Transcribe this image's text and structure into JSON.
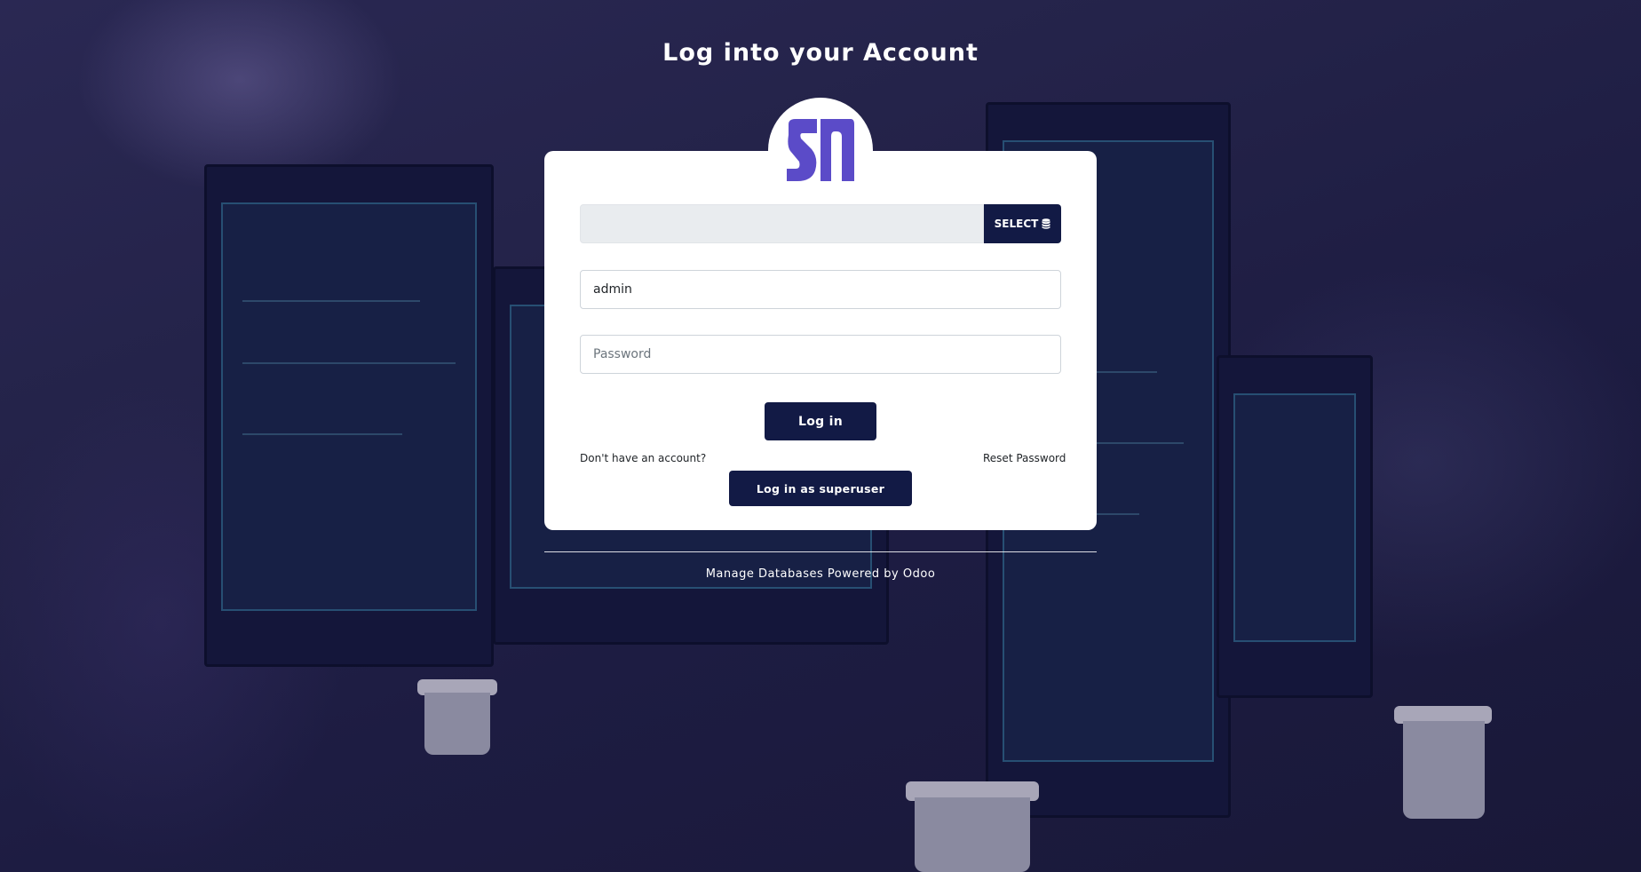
{
  "page": {
    "title": "Log into your Account"
  },
  "logo": {
    "icon": "brand-logo-icon",
    "color": "#5b4bc8"
  },
  "database": {
    "value": "",
    "select_label": "SELECT",
    "select_icon": "database-icon"
  },
  "login_form": {
    "login_value": "admin",
    "password_placeholder": "Password",
    "login_button": "Log in",
    "signup_link": "Don't have an account?",
    "reset_link": "Reset Password",
    "superuser_button": "Log in as superuser"
  },
  "footer": {
    "manage_databases": "Manage Databases",
    "powered_by": "Powered by",
    "odoo": "Odoo"
  },
  "colors": {
    "accent": "#121a45",
    "background": "#211f4a"
  }
}
